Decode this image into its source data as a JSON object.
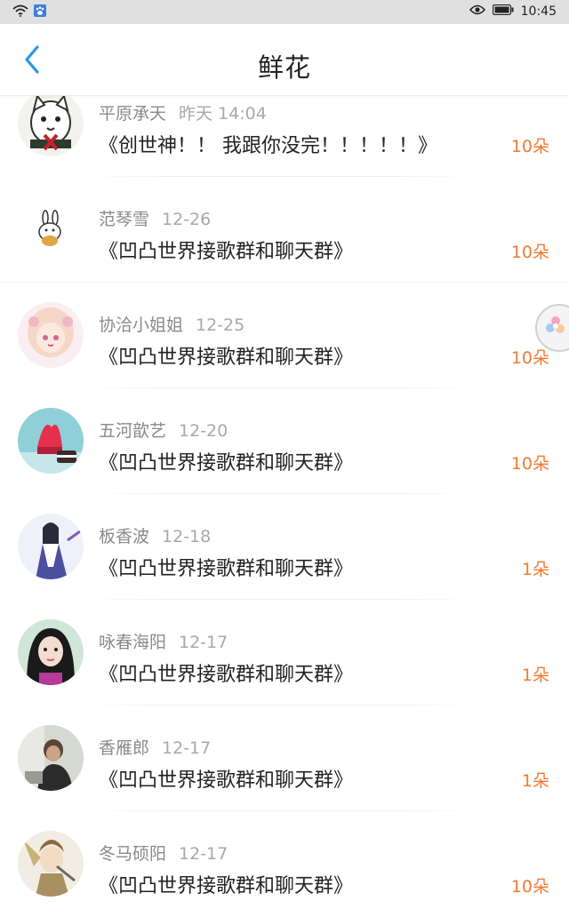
{
  "status_bar": {
    "time": "10:45",
    "icons": [
      "wifi-icon",
      "paw-app-icon",
      "eye-icon",
      "battery-icon"
    ]
  },
  "header": {
    "title": "鲜花",
    "back_icon": "chevron-left-icon"
  },
  "colors": {
    "accent": "#2b95e9",
    "count": "#f07a30",
    "name": "#8a8a8a",
    "date": "#a8a8a8"
  },
  "rows": [
    {
      "name": "平原承天",
      "date": "昨天 14:04",
      "title": "《创世神！！ 我跟你没完！！！！！》",
      "count": "10朵",
      "avatar": "cat-avatar"
    },
    {
      "name": "范琴雪",
      "date": "12-26",
      "title": "《凹凸世界接歌群和聊天群》",
      "count": "10朵",
      "avatar": "bunny-avatar"
    },
    {
      "name": "协洽小姐姐",
      "date": "12-25",
      "title": "《凹凸世界接歌群和聊天群》",
      "count": "10朵",
      "avatar": "anime-girl-avatar"
    },
    {
      "name": "五河歆艺",
      "date": "12-20",
      "title": "《凹凸世界接歌群和聊天群》",
      "count": "10朵",
      "avatar": "cake-avatar"
    },
    {
      "name": "板香波",
      "date": "12-18",
      "title": "《凹凸世界接歌群和聊天群》",
      "count": "1朵",
      "avatar": "ancient-style-avatar"
    },
    {
      "name": "咏春海阳",
      "date": "12-17",
      "title": "《凹凸世界接歌群和聊天群》",
      "count": "1朵",
      "avatar": "portrait-avatar"
    },
    {
      "name": "香雁郎",
      "date": "12-17",
      "title": "《凹凸世界接歌群和聊天群》",
      "count": "1朵",
      "avatar": "photo-avatar"
    },
    {
      "name": "冬马硕阳",
      "date": "12-17",
      "title": "《凹凸世界接歌群和聊天群》",
      "count": "10朵",
      "avatar": "warrior-avatar"
    }
  ]
}
